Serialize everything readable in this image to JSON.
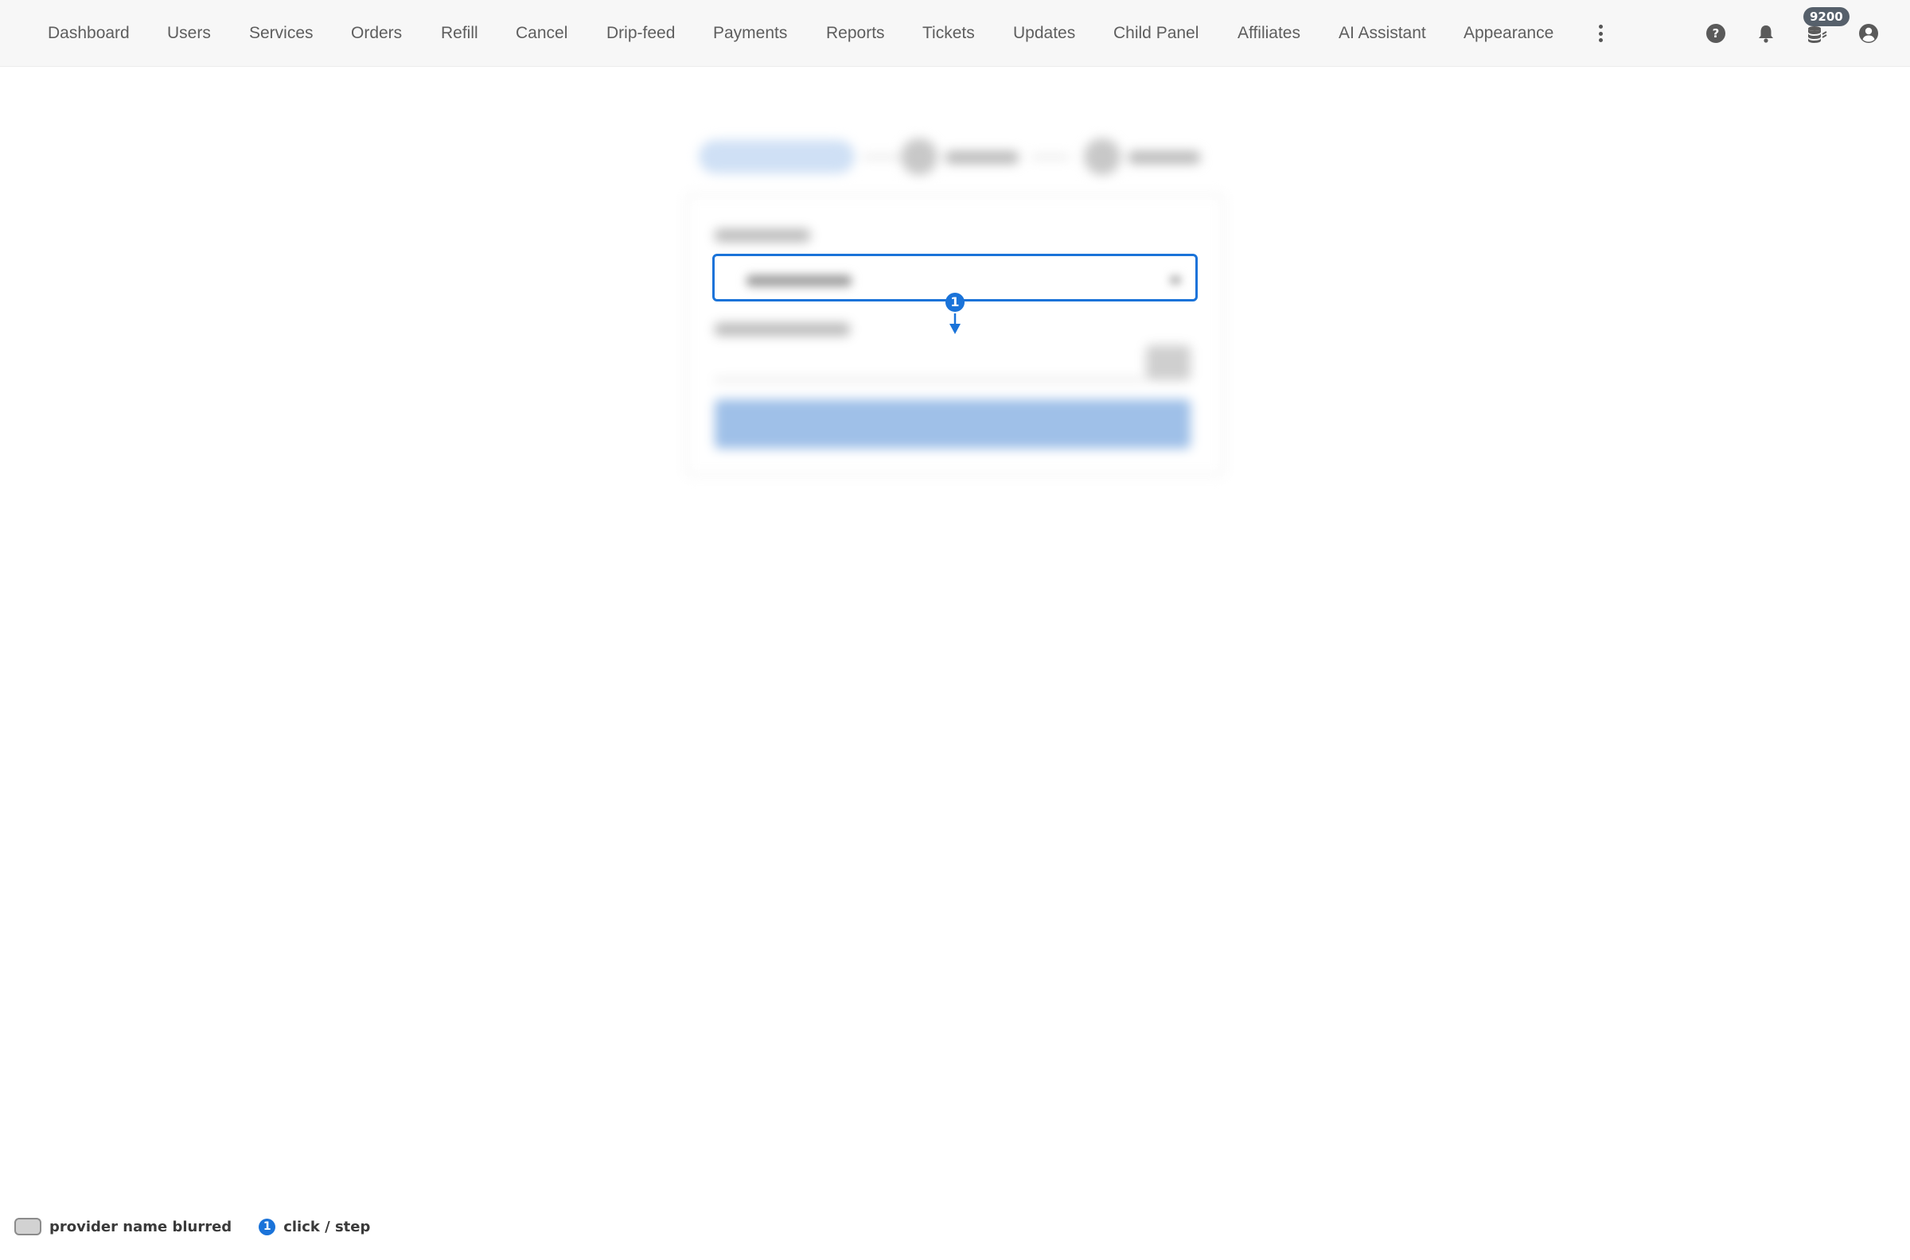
{
  "nav": {
    "items": [
      {
        "label": "Dashboard"
      },
      {
        "label": "Users"
      },
      {
        "label": "Services"
      },
      {
        "label": "Orders"
      },
      {
        "label": "Refill"
      },
      {
        "label": "Cancel"
      },
      {
        "label": "Drip-feed"
      },
      {
        "label": "Payments"
      },
      {
        "label": "Reports"
      },
      {
        "label": "Tickets"
      },
      {
        "label": "Updates"
      },
      {
        "label": "Child Panel"
      },
      {
        "label": "Affiliates"
      },
      {
        "label": "AI Assistant"
      },
      {
        "label": "Appearance"
      }
    ],
    "more_icon": "more-vertical-icon",
    "right_icons": {
      "help": "help-circle-icon",
      "notifications": "bell-icon",
      "balance": "coins-icon",
      "account": "account-circle-icon"
    },
    "balance_badge": "9200"
  },
  "annotation": {
    "step_number": "1"
  },
  "legend": {
    "blurred_label": "provider name blurred",
    "step_number": "1",
    "step_label": "click / step"
  },
  "colors": {
    "accent": "#1a73d9",
    "nav_bg": "#f7f7f7",
    "nav_text": "#5e5e5e",
    "badge_bg": "#56606b"
  }
}
